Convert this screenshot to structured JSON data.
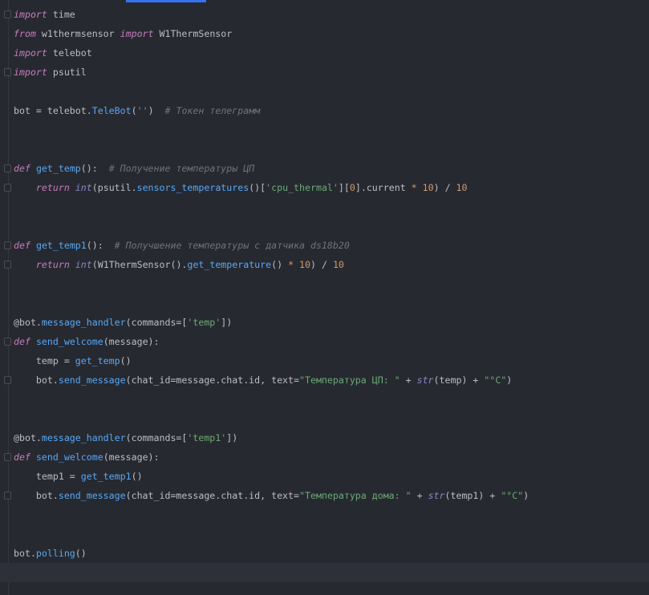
{
  "editor": {
    "lines": [
      [
        [
          "import",
          "kw"
        ],
        [
          " time",
          ""
        ]
      ],
      [
        [
          "from",
          "kw"
        ],
        [
          " w1thermsensor ",
          ""
        ],
        [
          "import",
          "kw"
        ],
        [
          " W1ThermSensor",
          ""
        ]
      ],
      [
        [
          "import",
          "kw"
        ],
        [
          " telebot",
          ""
        ]
      ],
      [
        [
          "import",
          "kw"
        ],
        [
          " psutil",
          ""
        ]
      ],
      [],
      [
        [
          "bot = telebot.",
          ""
        ],
        [
          "TeleBot",
          "fn"
        ],
        [
          "(",
          ""
        ],
        [
          "''",
          "str"
        ],
        [
          ")  ",
          ""
        ],
        [
          "# Токен телеграмм",
          "cmt"
        ]
      ],
      [],
      [],
      [
        [
          "def",
          "kw"
        ],
        [
          " ",
          ""
        ],
        [
          "get_temp",
          "fn"
        ],
        [
          "():  ",
          ""
        ],
        [
          "# Получение температуры ЦП",
          "cmt"
        ]
      ],
      [
        [
          "    ",
          ""
        ],
        [
          "return",
          "kw"
        ],
        [
          " ",
          ""
        ],
        [
          "int",
          "bi"
        ],
        [
          "(psutil.",
          ""
        ],
        [
          "sensors_temperatures",
          "fn"
        ],
        [
          "()[",
          ""
        ],
        [
          "'cpu_thermal'",
          "str"
        ],
        [
          "][",
          ""
        ],
        [
          "0",
          "num"
        ],
        [
          "].current ",
          ""
        ],
        [
          "*",
          "mul"
        ],
        [
          " ",
          ""
        ],
        [
          "10",
          "num"
        ],
        [
          ") / ",
          ""
        ],
        [
          "10",
          "num"
        ]
      ],
      [],
      [],
      [
        [
          "def",
          "kw"
        ],
        [
          " ",
          ""
        ],
        [
          "get_temp1",
          "fn"
        ],
        [
          "():  ",
          ""
        ],
        [
          "# Получшение температуры с датчика ds18b20",
          "cmt"
        ]
      ],
      [
        [
          "    ",
          ""
        ],
        [
          "return",
          "kw"
        ],
        [
          " ",
          ""
        ],
        [
          "int",
          "bi"
        ],
        [
          "(W1ThermSensor().",
          ""
        ],
        [
          "get_temperature",
          "fn"
        ],
        [
          "() ",
          ""
        ],
        [
          "*",
          "mul"
        ],
        [
          " ",
          ""
        ],
        [
          "10",
          "num"
        ],
        [
          ") / ",
          ""
        ],
        [
          "10",
          "num"
        ]
      ],
      [],
      [],
      [
        [
          "@bot.",
          ""
        ],
        [
          "message_handler",
          "fn"
        ],
        [
          "(commands=[",
          ""
        ],
        [
          "'temp'",
          "str"
        ],
        [
          "])",
          ""
        ]
      ],
      [
        [
          "def",
          "kw"
        ],
        [
          " ",
          ""
        ],
        [
          "send_welcome",
          "fn"
        ],
        [
          "(message):",
          ""
        ]
      ],
      [
        [
          "    temp = ",
          ""
        ],
        [
          "get_temp",
          "fn"
        ],
        [
          "()",
          ""
        ]
      ],
      [
        [
          "    bot.",
          ""
        ],
        [
          "send_message",
          "fn"
        ],
        [
          "(chat_id=message.chat.id, text=",
          ""
        ],
        [
          "\"Температура ЦП: \"",
          "str"
        ],
        [
          " + ",
          ""
        ],
        [
          "str",
          "bi"
        ],
        [
          "(temp) + ",
          ""
        ],
        [
          "\"°C\"",
          "str"
        ],
        [
          ")",
          ""
        ]
      ],
      [],
      [],
      [
        [
          "@bot.",
          ""
        ],
        [
          "message_handler",
          "fn"
        ],
        [
          "(commands=[",
          ""
        ],
        [
          "'temp1'",
          "str"
        ],
        [
          "])",
          ""
        ]
      ],
      [
        [
          "def",
          "kw"
        ],
        [
          " ",
          ""
        ],
        [
          "send_welcome",
          "fn"
        ],
        [
          "(message):",
          ""
        ]
      ],
      [
        [
          "    temp1 = ",
          ""
        ],
        [
          "get_temp1",
          "fn"
        ],
        [
          "()",
          ""
        ]
      ],
      [
        [
          "    bot.",
          ""
        ],
        [
          "send_message",
          "fn"
        ],
        [
          "(chat_id=message.chat.id, text=",
          ""
        ],
        [
          "\"Температура дома: \"",
          "str"
        ],
        [
          " + ",
          ""
        ],
        [
          "str",
          "bi"
        ],
        [
          "(temp1) + ",
          ""
        ],
        [
          "\"°C\"",
          "str"
        ],
        [
          ")",
          ""
        ]
      ],
      [],
      [],
      [
        [
          "bot.",
          ""
        ],
        [
          "polling",
          "fn"
        ],
        [
          "()",
          ""
        ]
      ],
      []
    ],
    "current_line": 29,
    "fold_markers": [
      0,
      3,
      8,
      9,
      12,
      13,
      17,
      19,
      23,
      25
    ]
  }
}
